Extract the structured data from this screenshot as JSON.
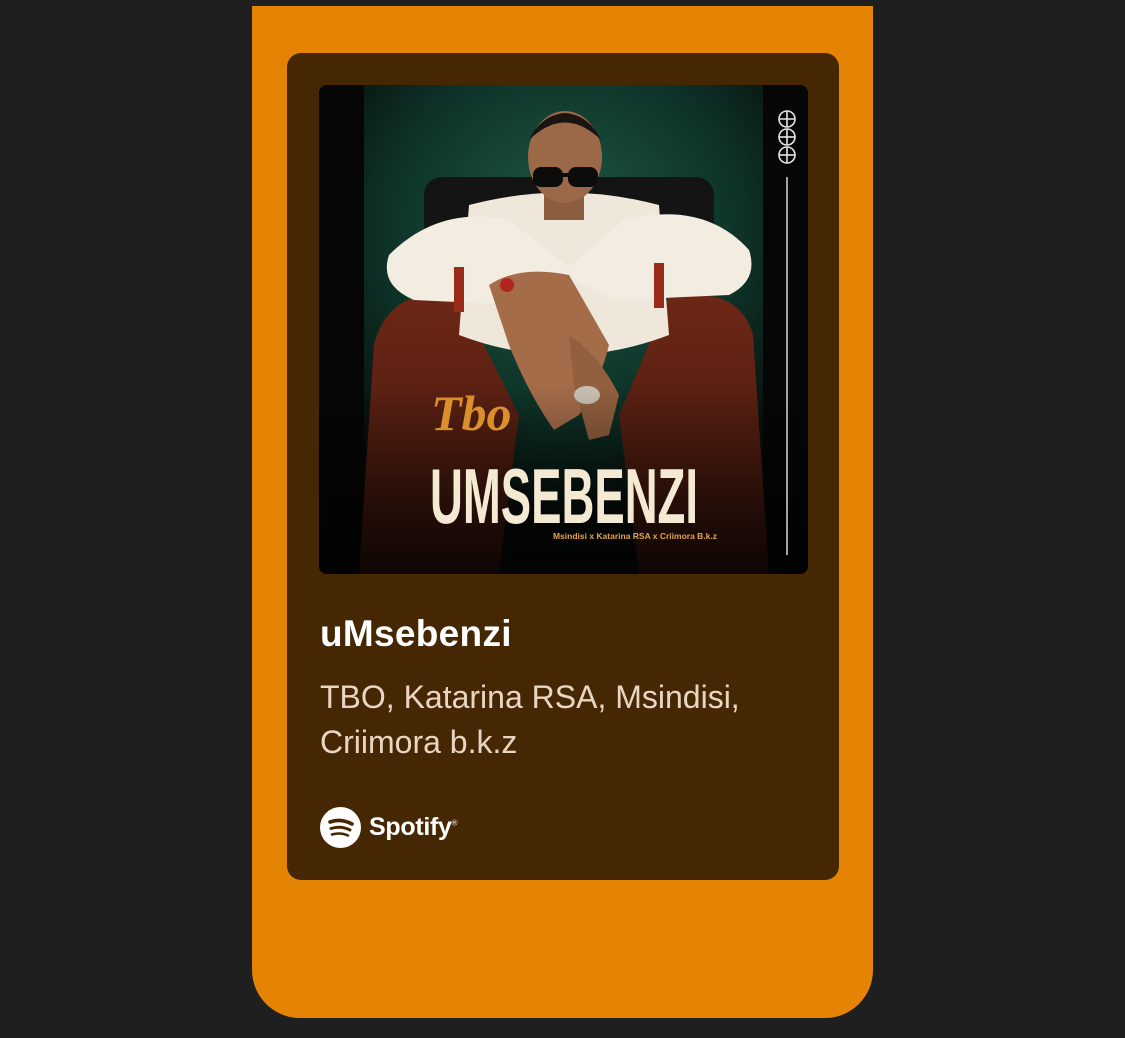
{
  "colors": {
    "page_background": "#1f1f1f",
    "accent": "#e58304",
    "card_background": "#452704",
    "title_text": "#ffffff",
    "artist_text": "#e9d6c2"
  },
  "cover_art": {
    "script_word": "Tbo",
    "headline": "UMSEBENZI",
    "credits": "Msindisi x Katarina RSA x Criimora B.k.z"
  },
  "track": {
    "title": "uMsebenzi",
    "artists": "TBO, Katarina RSA, Msindisi, Criimora b.k.z"
  },
  "brand": {
    "icon": "spotify-icon",
    "name": "Spotify",
    "registered_mark": "®"
  }
}
